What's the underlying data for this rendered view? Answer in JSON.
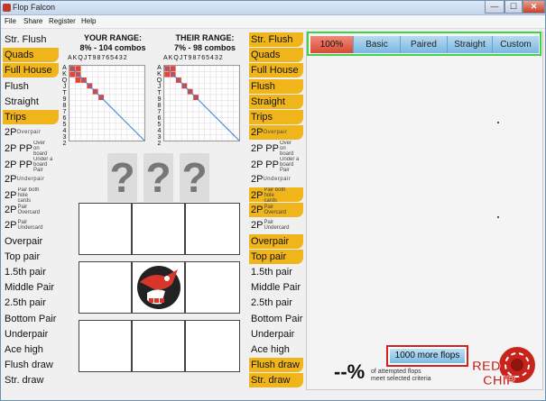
{
  "window": {
    "title": "Flop Falcon",
    "min": "—",
    "max": "☐",
    "close": "✕"
  },
  "menu": [
    "File",
    "Share",
    "Register",
    "Help"
  ],
  "your_range": {
    "title": "YOUR RANGE:",
    "detail": "8% - 104 combos"
  },
  "their_range": {
    "title": "THEIR RANGE:",
    "detail": "7% - 98 combos"
  },
  "rank_labels": "AKQJT98765432",
  "your_selected": [
    [
      0,
      0
    ],
    [
      0,
      1
    ],
    [
      1,
      0
    ],
    [
      1,
      1
    ],
    [
      2,
      1
    ],
    [
      2,
      2
    ],
    [
      3,
      3
    ],
    [
      4,
      4
    ],
    [
      5,
      5
    ]
  ],
  "their_selected": [
    [
      0,
      0
    ],
    [
      0,
      1
    ],
    [
      1,
      0
    ],
    [
      1,
      1
    ],
    [
      2,
      2
    ],
    [
      3,
      3
    ],
    [
      4,
      4
    ],
    [
      5,
      5
    ]
  ],
  "unknown_card": "?",
  "left_hands": [
    {
      "main": "Str. Flush",
      "on": false
    },
    {
      "main": "Quads",
      "on": true
    },
    {
      "main": "Full House",
      "on": true
    },
    {
      "main": "Flush",
      "on": false
    },
    {
      "main": "Straight",
      "on": false
    },
    {
      "main": "Trips",
      "on": true
    },
    {
      "main": "2P",
      "small": "Overpair",
      "on": false
    },
    {
      "main": "2P PP",
      "sub": "Over\non\nboard",
      "on": false
    },
    {
      "main": "2P PP",
      "sub": "Under a\nboard\nPair",
      "on": false
    },
    {
      "main": "2P",
      "small": "Underpair",
      "on": false
    },
    {
      "main": "2P",
      "sub": "Pair both\nhole\ncards",
      "on": false
    },
    {
      "main": "2P",
      "sub": "Pair\nOvercard",
      "on": false
    },
    {
      "main": "2P",
      "sub": "Pair\nUndercard",
      "on": false
    },
    {
      "main": "Overpair",
      "on": false
    },
    {
      "main": "Top pair",
      "on": false
    },
    {
      "main": "1.5th pair",
      "on": false
    },
    {
      "main": "Middle Pair",
      "on": false
    },
    {
      "main": "2.5th pair",
      "on": false
    },
    {
      "main": "Bottom Pair",
      "on": false
    },
    {
      "main": "Underpair",
      "on": false
    },
    {
      "main": "Ace high",
      "on": false
    },
    {
      "main": "Flush draw",
      "on": false
    },
    {
      "main": "Str. draw",
      "on": false
    }
  ],
  "right_hands": [
    {
      "main": "Str. Flush",
      "on": true
    },
    {
      "main": "Quads",
      "on": true
    },
    {
      "main": "Full House",
      "on": true
    },
    {
      "main": "Flush",
      "on": true
    },
    {
      "main": "Straight",
      "on": true
    },
    {
      "main": "Trips",
      "on": true
    },
    {
      "main": "2P",
      "small": "Overpair",
      "on": true
    },
    {
      "main": "2P PP",
      "sub": "Over\non\nboard",
      "on": false
    },
    {
      "main": "2P PP",
      "sub": "Under a\nboard\nPair",
      "on": false
    },
    {
      "main": "2P",
      "small": "Underpair",
      "on": false
    },
    {
      "main": "2P",
      "sub": "Pair both\nhole\ncards",
      "on": true
    },
    {
      "main": "2P",
      "sub": "Pair\nOvercard",
      "on": true
    },
    {
      "main": "2P",
      "sub": "Pair\nUndercard",
      "on": false
    },
    {
      "main": "Overpair",
      "on": true
    },
    {
      "main": "Top pair",
      "on": true
    },
    {
      "main": "1.5th pair",
      "on": false
    },
    {
      "main": "Middle Pair",
      "on": false
    },
    {
      "main": "2.5th pair",
      "on": false
    },
    {
      "main": "Bottom Pair",
      "on": false
    },
    {
      "main": "Underpair",
      "on": false
    },
    {
      "main": "Ace high",
      "on": false
    },
    {
      "main": "Flush draw",
      "on": true
    },
    {
      "main": "Str. draw",
      "on": true
    }
  ],
  "tabs": [
    "100%",
    "Basic",
    "Paired",
    "Straight",
    "Custom"
  ],
  "more_flops": "1000 more flops",
  "percentage": "--%",
  "percentage_desc": [
    "of attempted flops",
    "meet selected criteria"
  ],
  "logo_text": "RED CHIP",
  "colors": {
    "selected_cell": "#e0453a",
    "hand_on": "#f1b51c",
    "tab_active": "#d94a34",
    "tab_bg": "#77b7e4",
    "highlight_green": "#3fd24a",
    "highlight_red": "#d32020"
  }
}
